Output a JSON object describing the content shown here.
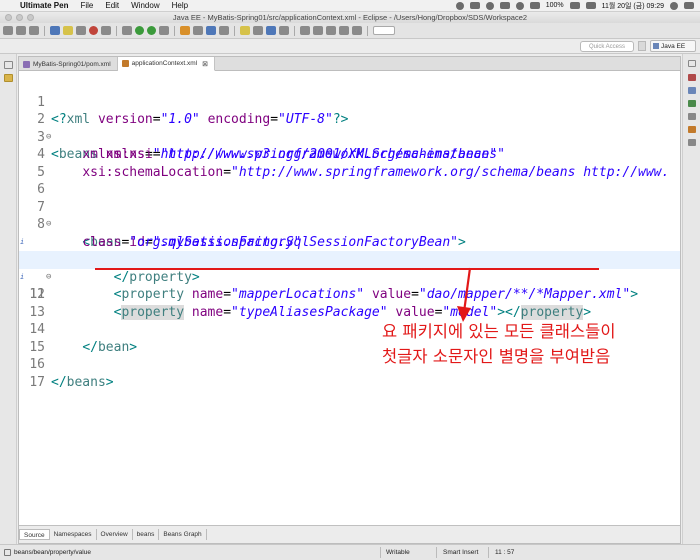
{
  "menubar": {
    "app_name": "Ultimate Pen",
    "items": [
      "File",
      "Edit",
      "Window",
      "Help"
    ],
    "battery": "100%",
    "clock": "11월 20일 (금) 09:29"
  },
  "window": {
    "title": "Java EE - MyBatis-Spring01/src/applicationContext.xml - Eclipse - /Users/Hong/Dropbox/SDS/Workspace2"
  },
  "toolbar": {
    "quick_access_placeholder": "Quick Access",
    "perspective_label": "Java EE"
  },
  "editor_tabs": [
    {
      "label": "MyBatis-Spring01/pom.xml",
      "active": false
    },
    {
      "label": "applicationContext.xml",
      "active": true,
      "close": "⊠"
    }
  ],
  "code": {
    "lines": [
      {
        "n": "1",
        "fold": ""
      },
      {
        "n": "2",
        "fold": "⊖"
      },
      {
        "n": "3",
        "fold": ""
      },
      {
        "n": "4",
        "fold": ""
      },
      {
        "n": "5",
        "fold": ""
      },
      {
        "n": "6",
        "fold": ""
      },
      {
        "n": "7",
        "fold": "⊖"
      },
      {
        "n": "8",
        "fold": ""
      },
      {
        "n": "9",
        "fold": "⊖"
      },
      {
        "n": "10",
        "fold": ""
      },
      {
        "n": "11",
        "fold": ""
      },
      {
        "n": "12",
        "fold": ""
      },
      {
        "n": "13",
        "fold": ""
      },
      {
        "n": "14",
        "fold": ""
      },
      {
        "n": "15",
        "fold": ""
      },
      {
        "n": "16",
        "fold": ""
      },
      {
        "n": "17",
        "fold": ""
      }
    ],
    "s": {
      "l1_open": "<?",
      "l1_tag": "xml",
      "l1_a1": "version",
      "l1_eq": "=",
      "l1_v1": "\"1.0\"",
      "l1_a2": "encoding",
      "l1_v2": "\"UTF-8\"",
      "l1_close": "?>",
      "lt": "<",
      "gt": ">",
      "ltslash": "</",
      "eq": "=",
      "beans": "beans",
      "xmlns": "xmlns",
      "xmlns_v": "\"http://www.springframework.org/schema/beans\"",
      "xsi": "xmlns:xsi",
      "xsi_v": "\"http://www.w3.org/2001/XMLSchema-instance\"",
      "schemaloc": "xsi:schemaLocation",
      "schemaloc_v": "\"http://www.springframework.org/schema/beans http://www.",
      "bean": "bean",
      "id": "id",
      "id_v": "\"sqlSessionFactory\"",
      "class": "class",
      "class_v": "\"org.mybatis.spring.SqlSessionFactoryBean\"",
      "property": "property",
      "name": "name",
      "value": "value",
      "ml_v": "\"mapperLocations\"",
      "ml_value_v": "\"dao/mapper/**/*Mapper.xml\"",
      "tap_v": "\"typeAliasesPackage\"",
      "model_v": "\"model\""
    }
  },
  "annotation": {
    "line1": "요 패키지에 있는 모든 클래스들이",
    "line2": "첫글자 소문자인 별명을 부여받음",
    "color": "#e21818"
  },
  "bottom_tabs": [
    "Source",
    "Namespaces",
    "Overview",
    "beans",
    "Beans Graph"
  ],
  "statusbar": {
    "path": "beans/bean/property/value",
    "writable": "Writable",
    "insert_mode": "Smart Insert",
    "position": "11 : 57"
  }
}
